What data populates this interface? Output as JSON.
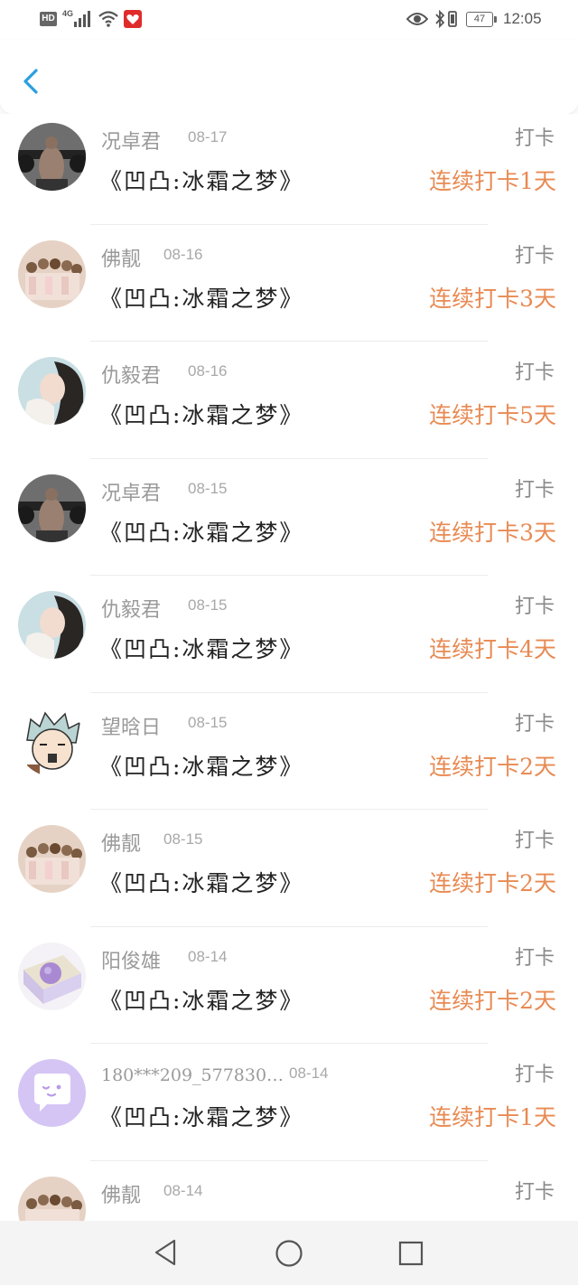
{
  "status_bar": {
    "hd": "HD",
    "network": "4G",
    "battery": "47",
    "time": "12:05"
  },
  "header": {
    "back_icon": "chevron-left-icon",
    "accent": "#2a9fe0"
  },
  "colors": {
    "streak": "#e88a53",
    "name": "#9a9a9a",
    "book": "#222222"
  },
  "entries": [
    {
      "name": "况卓君",
      "date": "08-17",
      "book": "《凹凸:冰霜之梦》",
      "tag": "打卡",
      "streak": "连续打卡1天",
      "avatar": "avatar-gym"
    },
    {
      "name": "佛靓",
      "date": "08-16",
      "book": "《凹凸:冰霜之梦》",
      "tag": "打卡",
      "streak": "连续打卡3天",
      "avatar": "avatar-group"
    },
    {
      "name": "仇毅君",
      "date": "08-16",
      "book": "《凹凸:冰霜之梦》",
      "tag": "打卡",
      "streak": "连续打卡5天",
      "avatar": "avatar-girl"
    },
    {
      "name": "况卓君",
      "date": "08-15",
      "book": "《凹凸:冰霜之梦》",
      "tag": "打卡",
      "streak": "连续打卡3天",
      "avatar": "avatar-gym"
    },
    {
      "name": "仇毅君",
      "date": "08-15",
      "book": "《凹凸:冰霜之梦》",
      "tag": "打卡",
      "streak": "连续打卡4天",
      "avatar": "avatar-girl"
    },
    {
      "name": "望晗日",
      "date": "08-15",
      "book": "《凹凸:冰霜之梦》",
      "tag": "打卡",
      "streak": "连续打卡2天",
      "avatar": "avatar-anime"
    },
    {
      "name": "佛靓",
      "date": "08-15",
      "book": "《凹凸:冰霜之梦》",
      "tag": "打卡",
      "streak": "连续打卡2天",
      "avatar": "avatar-group"
    },
    {
      "name": "阳俊雄",
      "date": "08-14",
      "book": "《凹凸:冰霜之梦》",
      "tag": "打卡",
      "streak": "连续打卡2天",
      "avatar": "avatar-box"
    },
    {
      "name": "180***209_577830…",
      "date": "08-14",
      "book": "《凹凸:冰霜之梦》",
      "tag": "打卡",
      "streak": "连续打卡1天",
      "avatar": "avatar-chat"
    },
    {
      "name": "佛靓",
      "date": "08-14",
      "book": "",
      "tag": "打卡",
      "streak": "",
      "avatar": "avatar-group"
    }
  ],
  "navbar": {
    "back_icon": "triangle-back-icon",
    "home_icon": "circle-home-icon",
    "recent_icon": "square-recent-icon"
  }
}
